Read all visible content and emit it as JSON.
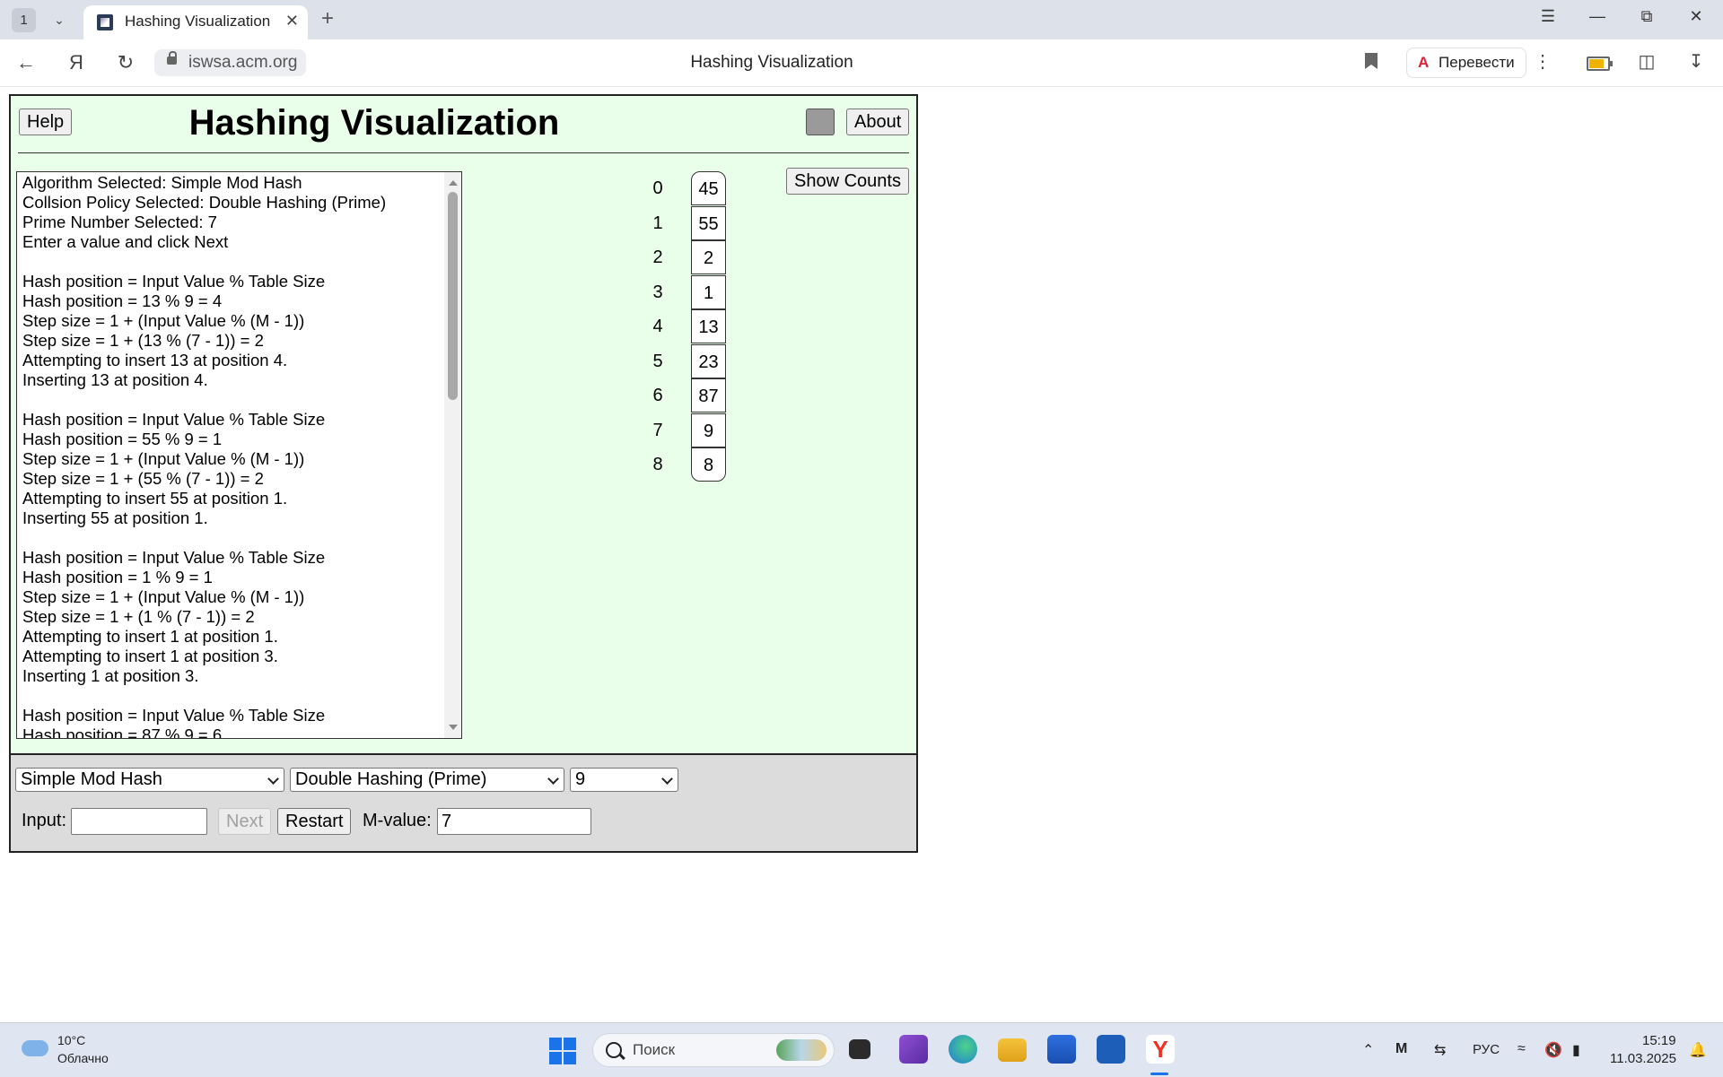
{
  "browser": {
    "tab_count": "1",
    "tab_title": "Hashing Visualization",
    "url": "iswsa.acm.org",
    "page_title": "Hashing Visualization",
    "translate_label": "Перевести"
  },
  "app": {
    "title": "Hashing Visualization",
    "help_label": "Help",
    "about_label": "About",
    "show_counts_label": "Show Counts",
    "log_lines": [
      "Algorithm Selected: Simple Mod Hash",
      "Collsion Policy Selected: Double Hashing (Prime)",
      "Prime Number Selected: 7",
      "Enter a value and click Next",
      "",
      "Hash position = Input Value % Table Size",
      "Hash position = 13 % 9 = 4",
      "Step size = 1 + (Input Value % (M - 1))",
      "Step size = 1 + (13 % (7 - 1)) = 2",
      "Attempting to insert 13 at position 4.",
      "Inserting 13 at position 4.",
      "",
      "Hash position = Input Value % Table Size",
      "Hash position = 55 % 9 = 1",
      "Step size = 1 + (Input Value % (M - 1))",
      "Step size = 1 + (55 % (7 - 1)) = 2",
      "Attempting to insert 55 at position 1.",
      "Inserting 55 at position 1.",
      "",
      "Hash position = Input Value % Table Size",
      "Hash position = 1 % 9 = 1",
      "Step size = 1 + (Input Value % (M - 1))",
      "Step size = 1 + (1 % (7 - 1)) = 2",
      "Attempting to insert 1 at position 1.",
      "Attempting to insert 1 at position 3.",
      "Inserting 1 at position 3.",
      "",
      "Hash position = Input Value % Table Size",
      "Hash position = 87 % 9 = 6"
    ],
    "table": [
      {
        "index": "0",
        "value": "45"
      },
      {
        "index": "1",
        "value": "55"
      },
      {
        "index": "2",
        "value": "2"
      },
      {
        "index": "3",
        "value": "1"
      },
      {
        "index": "4",
        "value": "13"
      },
      {
        "index": "5",
        "value": "23"
      },
      {
        "index": "6",
        "value": "87"
      },
      {
        "index": "7",
        "value": "9"
      },
      {
        "index": "8",
        "value": "8"
      }
    ],
    "controls": {
      "algorithm_selected": "Simple Mod Hash",
      "policy_selected": "Double Hashing (Prime)",
      "table_size_selected": "9",
      "input_label": "Input:",
      "input_value": "",
      "next_label": "Next",
      "restart_label": "Restart",
      "mvalue_label": "M-value:",
      "mvalue_value": "7"
    }
  },
  "taskbar": {
    "temperature": "10°C",
    "weather": "Облачно",
    "search_placeholder": "Поиск",
    "language": "РУС",
    "time": "15:19",
    "date": "11.03.2025"
  },
  "colors": {
    "app_background": "#eaffea",
    "controls_background": "#dcdcdc",
    "swatch": "#9a9a9a"
  }
}
